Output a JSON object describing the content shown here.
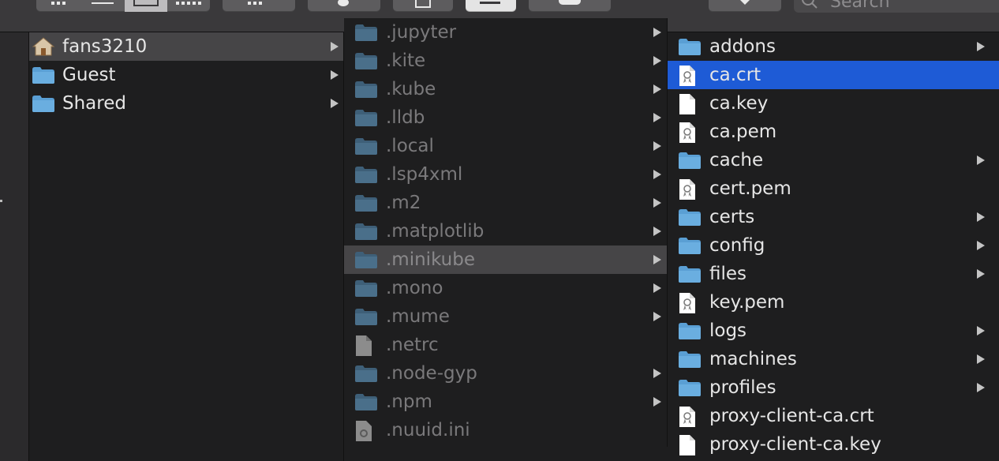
{
  "toolbar": {
    "search_placeholder": "Search"
  },
  "columns": [
    {
      "items": [
        {
          "label": "fans3210",
          "icon": "home-folder-icon",
          "has_children": true,
          "state": "selected-inactive"
        },
        {
          "label": "Guest",
          "icon": "folder-icon",
          "has_children": true,
          "state": "normal"
        },
        {
          "label": "Shared",
          "icon": "folder-icon",
          "has_children": true,
          "state": "normal"
        }
      ]
    },
    {
      "items": [
        {
          "label": ".jupyter",
          "icon": "folder-icon",
          "has_children": true,
          "state": "normal"
        },
        {
          "label": ".kite",
          "icon": "folder-icon",
          "has_children": true,
          "state": "normal"
        },
        {
          "label": ".kube",
          "icon": "folder-icon",
          "has_children": true,
          "state": "normal"
        },
        {
          "label": ".lldb",
          "icon": "folder-icon",
          "has_children": true,
          "state": "normal"
        },
        {
          "label": ".local",
          "icon": "folder-icon",
          "has_children": true,
          "state": "normal"
        },
        {
          "label": ".lsp4xml",
          "icon": "folder-icon",
          "has_children": true,
          "state": "normal"
        },
        {
          "label": ".m2",
          "icon": "folder-icon",
          "has_children": true,
          "state": "normal"
        },
        {
          "label": ".matplotlib",
          "icon": "folder-icon",
          "has_children": true,
          "state": "normal"
        },
        {
          "label": ".minikube",
          "icon": "folder-icon",
          "has_children": true,
          "state": "selected-inactive"
        },
        {
          "label": ".mono",
          "icon": "folder-icon",
          "has_children": true,
          "state": "normal"
        },
        {
          "label": ".mume",
          "icon": "folder-icon",
          "has_children": true,
          "state": "normal"
        },
        {
          "label": ".netrc",
          "icon": "document-icon",
          "has_children": false,
          "state": "normal"
        },
        {
          "label": ".node-gyp",
          "icon": "folder-icon",
          "has_children": true,
          "state": "normal"
        },
        {
          "label": ".npm",
          "icon": "folder-icon",
          "has_children": true,
          "state": "normal"
        },
        {
          "label": ".nuuid.ini",
          "icon": "settings-document-icon",
          "has_children": false,
          "state": "normal"
        }
      ]
    },
    {
      "items": [
        {
          "label": "addons",
          "icon": "folder-icon",
          "has_children": true,
          "state": "normal"
        },
        {
          "label": "ca.crt",
          "icon": "certificate-icon",
          "has_children": false,
          "state": "selected"
        },
        {
          "label": "ca.key",
          "icon": "document-icon",
          "has_children": false,
          "state": "normal"
        },
        {
          "label": "ca.pem",
          "icon": "certificate-icon",
          "has_children": false,
          "state": "normal"
        },
        {
          "label": "cache",
          "icon": "folder-icon",
          "has_children": true,
          "state": "normal"
        },
        {
          "label": "cert.pem",
          "icon": "certificate-icon",
          "has_children": false,
          "state": "normal"
        },
        {
          "label": "certs",
          "icon": "folder-icon",
          "has_children": true,
          "state": "normal"
        },
        {
          "label": "config",
          "icon": "folder-icon",
          "has_children": true,
          "state": "normal"
        },
        {
          "label": "files",
          "icon": "folder-icon",
          "has_children": true,
          "state": "normal"
        },
        {
          "label": "key.pem",
          "icon": "certificate-icon",
          "has_children": false,
          "state": "normal"
        },
        {
          "label": "logs",
          "icon": "folder-icon",
          "has_children": true,
          "state": "normal"
        },
        {
          "label": "machines",
          "icon": "folder-icon",
          "has_children": true,
          "state": "normal"
        },
        {
          "label": "profiles",
          "icon": "folder-icon",
          "has_children": true,
          "state": "normal"
        },
        {
          "label": "proxy-client-ca.crt",
          "icon": "certificate-icon",
          "has_children": false,
          "state": "normal"
        },
        {
          "label": "proxy-client-ca.key",
          "icon": "document-icon",
          "has_children": false,
          "state": "normal"
        }
      ]
    }
  ],
  "colors": {
    "selection_active": "#1e5bd6",
    "selection_inactive": "#464547",
    "folder": "#6aaee0"
  }
}
